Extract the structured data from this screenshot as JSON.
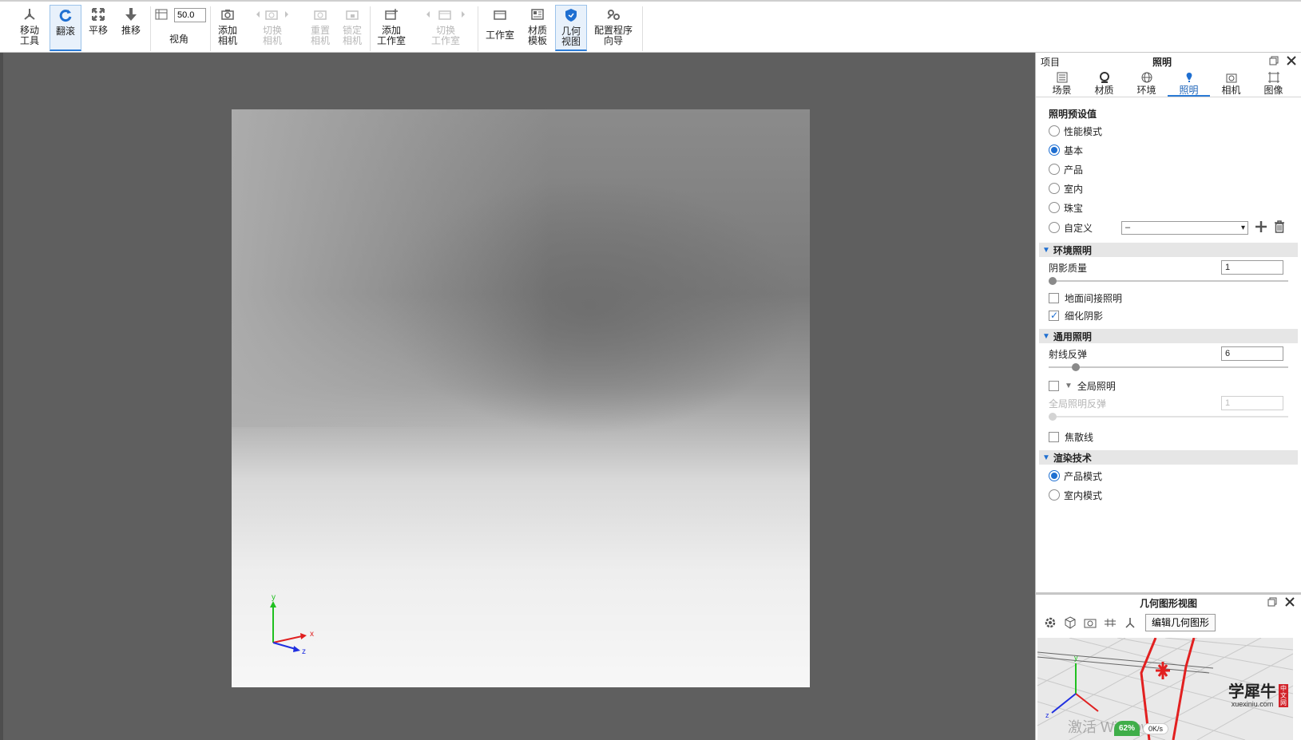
{
  "toolbar": {
    "move_tool": "移动\n工具",
    "tumble": "翻滚",
    "pan": "平移",
    "dolly": "推移",
    "fov_value": "50.0",
    "fov_label": "视角",
    "add_camera": "添加\n相机",
    "switch_camera": "切换\n相机",
    "reset_camera": "重置\n相机",
    "lock_camera": "锁定\n相机",
    "add_studio": "添加\n工作室",
    "switch_studio": "切换\n工作室",
    "studio": "工作室",
    "material_templates": "材质\n模板",
    "geometry_view": "几何\n视图",
    "config_wizard": "配置程序\n向导"
  },
  "panel": {
    "left_title": "项目",
    "title": "照明",
    "tabs": [
      {
        "label": "场景",
        "icon": "list-icon"
      },
      {
        "label": "材质",
        "icon": "sphere-icon"
      },
      {
        "label": "环境",
        "icon": "globe-icon"
      },
      {
        "label": "照明",
        "icon": "bulb-icon"
      },
      {
        "label": "相机",
        "icon": "camera-icon"
      },
      {
        "label": "图像",
        "icon": "crop-icon"
      }
    ],
    "preset_label": "照明预设值",
    "presets": [
      {
        "label": "性能模式",
        "selected": false
      },
      {
        "label": "基本",
        "selected": true
      },
      {
        "label": "产品",
        "selected": false
      },
      {
        "label": "室内",
        "selected": false
      },
      {
        "label": "珠宝",
        "selected": false
      },
      {
        "label": "自定义",
        "selected": false
      }
    ],
    "custom_value": "–",
    "env_group": "环境照明",
    "shadow_quality_label": "阴影质量",
    "shadow_quality_value": "1",
    "shadow_quality_fraction": 0.0,
    "ground_indirect": "地面间接照明",
    "ground_indirect_checked": false,
    "refine_shadows": "细化阴影",
    "refine_shadows_checked": true,
    "general_group": "通用照明",
    "ray_bounces_label": "射线反弹",
    "ray_bounces_value": "6",
    "ray_bounces_fraction": 0.1,
    "global_illum": "全局照明",
    "global_illum_checked": false,
    "gi_bounces_label": "全局照明反弹",
    "gi_bounces_value": "1",
    "caustics": "焦散线",
    "caustics_checked": false,
    "render_group": "渲染技术",
    "render_modes": [
      {
        "label": "产品模式",
        "selected": true
      },
      {
        "label": "室内模式",
        "selected": false
      }
    ]
  },
  "geo": {
    "title": "几何图形视图",
    "edit_button": "编辑几何图形",
    "watermark": "激活 Windows",
    "logo_text": "学犀牛",
    "logo_sub": "xuexiniu.com",
    "logo_badge": "中文网",
    "speed": "0K/s",
    "percent": "62%"
  },
  "viewport": {
    "axis_x": "x",
    "axis_y": "y",
    "axis_z": "z"
  }
}
